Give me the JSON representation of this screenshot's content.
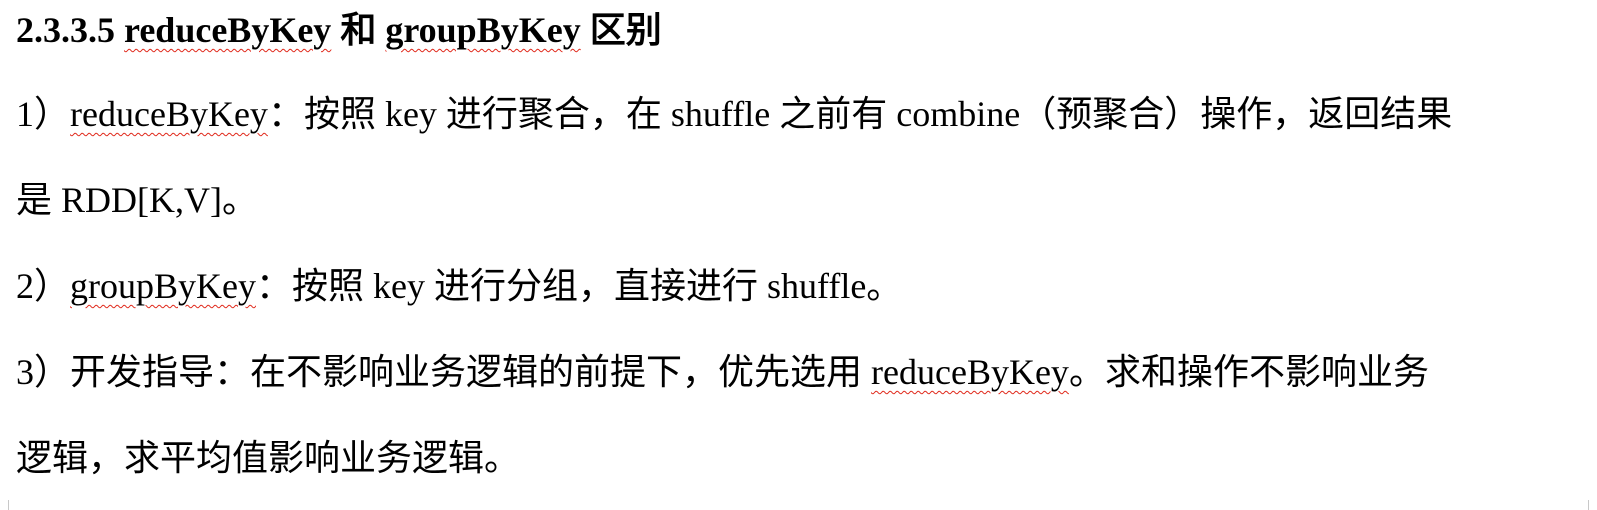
{
  "heading": {
    "number": "2.3.3.5 ",
    "term1": "reduceByKey",
    "mid": " 和 ",
    "term2": "groupByKey",
    "tail": " 区别"
  },
  "item1": {
    "prefix": "1）",
    "term": "reduceByKey",
    "text": "：按照 key 进行聚合，在 shuffle 之前有 combine（预聚合）操作，返回结果",
    "continuation": "是 RDD[K,V]。"
  },
  "item2": {
    "prefix": "2）",
    "term": "groupByKey",
    "text": "：按照 key 进行分组，直接进行 shuffle。"
  },
  "item3": {
    "prefix": "3）开发指导：在不影响业务逻辑的前提下，优先选用 ",
    "term": "reduceByKey",
    "text": "。求和操作不影响业务",
    "continuation": "逻辑，求平均值影响业务逻辑。"
  }
}
